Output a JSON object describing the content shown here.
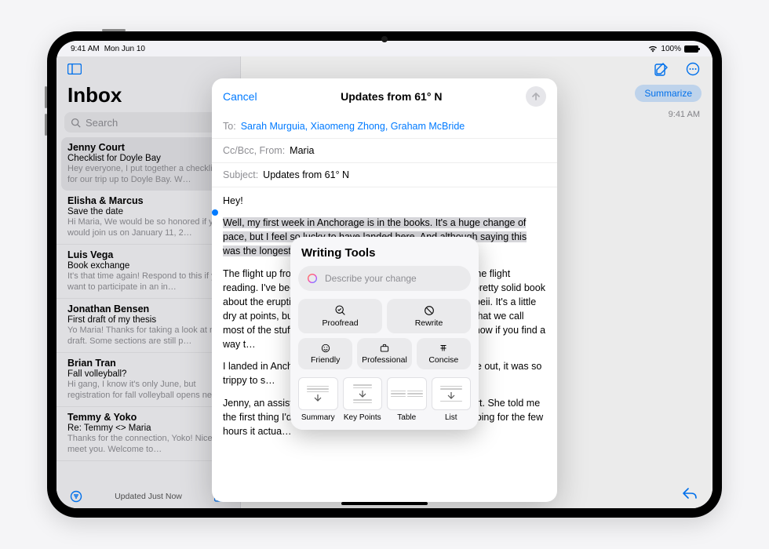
{
  "status": {
    "time": "9:41 AM",
    "date": "Mon Jun 10",
    "battery": "100%"
  },
  "sidebar": {
    "title": "Inbox",
    "search_placeholder": "Search",
    "footer_status": "Updated Just Now",
    "messages": [
      {
        "sender": "Jenny Court",
        "subject": "Checklist for Doyle Bay",
        "preview": "Hey everyone, I put together a checklist for our trip up to Doyle Bay. W…"
      },
      {
        "sender": "Elisha & Marcus",
        "subject": "Save the date",
        "preview": "Hi Maria, We would be so honored if you would join us on January 11, 2…"
      },
      {
        "sender": "Luis Vega",
        "subject": "Book exchange",
        "preview": "It's that time again! Respond to this if you want to participate in an in…"
      },
      {
        "sender": "Jonathan Bensen",
        "subject": "First draft of my thesis",
        "preview": "Yo Maria! Thanks for taking a look at my draft. Some sections are still p…"
      },
      {
        "sender": "Brian Tran",
        "subject": "Fall volleyball?",
        "preview": "Hi gang, I know it's only June, but registration for fall volleyball opens ne…"
      },
      {
        "sender": "Temmy & Yoko",
        "subject": "Re: Temmy <> Maria",
        "preview": "Thanks for the connection, Yoko! Nice to meet you. Welcome to…"
      }
    ]
  },
  "main": {
    "summarize_label": "Summarize",
    "time": "9:41 AM"
  },
  "compose": {
    "cancel": "Cancel",
    "title": "Updates from 61° N",
    "to_label": "To:",
    "recipients": "Sarah Murguia, Xiaomeng Zhong, Graham McBride",
    "ccbcc_label": "Cc/Bcc, From:",
    "from_value": "Maria",
    "subject_label": "Subject:",
    "subject_value": "Updates from 61° N",
    "greeting": "Hey!",
    "para1": "Well, my first week in Anchorage is in the books. It's a huge change of pace, but I feel so lucky to have landed here. And although saying this was the longest week of my life, in",
    "para2": "The flight up from Seattle was uneventful. I spent most of the flight reading. I've been on a history kick lately and picked up a pretty solid book about the eruption of Vesuvius and the destruction of Pompeii. It's a little dry at points, but I did learn a new word: tephra, which is what we call most of the stuff a volcano spews when it erupts. Let me know if you find a way t…",
    "para3": "I landed in Anchorage at 11:30pm and the sun would still be out, it was so trippy to s…",
    "para4": "Jenny, an assistant at the lab, picked me up from the airport. She told me the first thing I'd notice is that the sun is basically only sleeping for the few hours it actua…"
  },
  "writing_tools": {
    "title": "Writing Tools",
    "placeholder": "Describe your change",
    "actions": {
      "proofread": "Proofread",
      "rewrite": "Rewrite",
      "friendly": "Friendly",
      "professional": "Professional",
      "concise": "Concise"
    },
    "formats": {
      "summary": "Summary",
      "keypoints": "Key Points",
      "table": "Table",
      "list": "List"
    }
  }
}
